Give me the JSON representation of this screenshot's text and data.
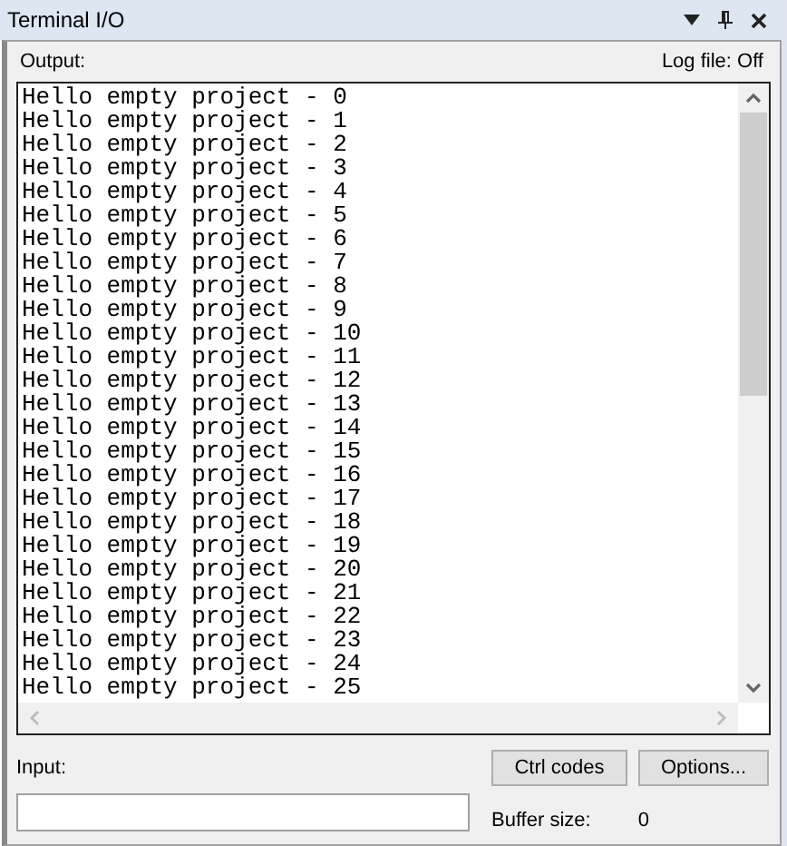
{
  "window": {
    "title": "Terminal I/O"
  },
  "output": {
    "label": "Output:",
    "log_file": "Log file: Off",
    "lines": [
      "Hello empty project - 0",
      "Hello empty project - 1",
      "Hello empty project - 2",
      "Hello empty project - 3",
      "Hello empty project - 4",
      "Hello empty project - 5",
      "Hello empty project - 6",
      "Hello empty project - 7",
      "Hello empty project - 8",
      "Hello empty project - 9",
      "Hello empty project - 10",
      "Hello empty project - 11",
      "Hello empty project - 12",
      "Hello empty project - 13",
      "Hello empty project - 14",
      "Hello empty project - 15",
      "Hello empty project - 16",
      "Hello empty project - 17",
      "Hello empty project - 18",
      "Hello empty project - 19",
      "Hello empty project - 20",
      "Hello empty project - 21",
      "Hello empty project - 22",
      "Hello empty project - 23",
      "Hello empty project - 24",
      "Hello empty project - 25"
    ]
  },
  "input": {
    "label": "Input:"
  },
  "buttons": [
    "Ctrl codes",
    "Options..."
  ],
  "buffer": {
    "label": "Buffer size:",
    "value": "0"
  }
}
